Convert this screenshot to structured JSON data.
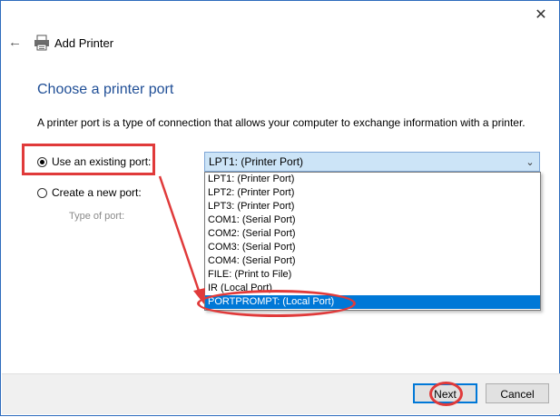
{
  "window": {
    "close_icon": "close-icon",
    "back_icon": "back-arrow-icon",
    "app_icon": "printer-icon",
    "title": "Add Printer"
  },
  "main": {
    "heading": "Choose a printer port",
    "description": "A printer port is a type of connection that allows your computer to exchange information with a printer.",
    "use_existing_label": "Use an existing port:",
    "create_new_label": "Create a new port:",
    "type_of_port_label": "Type of port:"
  },
  "port_select": {
    "selected_value": "LPT1: (Printer Port)",
    "options": [
      "LPT1: (Printer Port)",
      "LPT2: (Printer Port)",
      "LPT3: (Printer Port)",
      "COM1: (Serial Port)",
      "COM2: (Serial Port)",
      "COM3: (Serial Port)",
      "COM4: (Serial Port)",
      "FILE: (Print to File)",
      "IR (Local Port)",
      "PORTPROMPT: (Local Port)"
    ],
    "highlighted_option": "PORTPROMPT: (Local Port)"
  },
  "footer": {
    "next_label": "Next",
    "cancel_label": "Cancel"
  },
  "colors": {
    "accent": "#0078d7",
    "heading": "#1f4e96",
    "annotation": "#e03a3a",
    "combo_bg": "#cce4f7"
  }
}
